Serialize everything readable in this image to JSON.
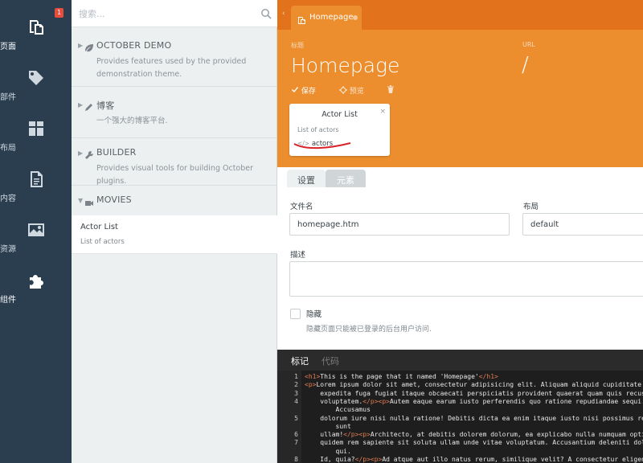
{
  "nav": {
    "badge": "1",
    "items": [
      {
        "label": "页面",
        "icon": "pages-icon"
      },
      {
        "label": "部件",
        "icon": "partials-icon"
      },
      {
        "label": "布局",
        "icon": "layouts-icon"
      },
      {
        "label": "内容",
        "icon": "content-icon"
      },
      {
        "label": "资源",
        "icon": "assets-icon"
      },
      {
        "label": "组件",
        "icon": "components-icon"
      }
    ]
  },
  "sidebar": {
    "search_placeholder": "搜索...",
    "groups": [
      {
        "title": "OCTOBER DEMO",
        "desc": "Provides features used by the provided demonstration theme."
      },
      {
        "title": "博客",
        "desc": "一个强大的博客平台."
      },
      {
        "title": "BUILDER",
        "desc": "Provides visual tools for building October plugins."
      },
      {
        "title": "MOVIES",
        "desc": ""
      }
    ],
    "component": {
      "title": "Actor List",
      "desc": "List of actors"
    }
  },
  "main": {
    "tab_label": "Homepage",
    "title_label": "标题",
    "title_value": "Homepage",
    "url_label": "URL",
    "url_value": "/",
    "toolbar": {
      "save": "保存",
      "preview": "预览"
    },
    "component_card": {
      "title": "Actor List",
      "close": "×",
      "desc": "List of actors",
      "code_icon": "</>",
      "alias": "actors"
    },
    "form_tabs": {
      "settings": "设置",
      "elements": "元素"
    },
    "file_name_label": "文件名",
    "file_name_value": "homepage.htm",
    "layout_label": "布局",
    "layout_value": "default",
    "description_label": "描述",
    "description_value": "",
    "hidden_label": "隐藏",
    "hidden_help": "隐藏页面只能被已登录的后台用户访问.",
    "code_tabs": {
      "markup": "标记",
      "code": "代码"
    },
    "code_lines": [
      {
        "n": "1",
        "text": "<h1>This is the page that it named 'Homepage'</h1>"
      },
      {
        "n": "2",
        "text": "<p>Lorem ipsum dolor sit amet, consectetur adipisicing elit. Aliquam aliquid cupiditate"
      },
      {
        "n": "3",
        "text": "    expedita fuga fugiat itaque obcaecati perspiciatis provident quaerat quam quis recusa"
      },
      {
        "n": "4",
        "text": "    voluptatem.</p><p>Autem eaque earum iusto perferendis quo ratione repudiandae sequi."
      },
      {
        "n": "",
        "text": "        Accusamus"
      },
      {
        "n": "5",
        "text": "    dolorum iure nisi nulla ratione! Debitis dicta ea enim itaque iusto nisi possimus re"
      },
      {
        "n": "",
        "text": "        sunt"
      },
      {
        "n": "6",
        "text": "    ullam!</p><p>Architecto, at debitis dolorem dolorum, ea explicabo nulla numquam opti"
      },
      {
        "n": "7",
        "text": "    quidem rem sapiente sit soluta ullam unde vitae voluptatum. Accusantium deleniti dol"
      },
      {
        "n": "",
        "text": "        qui."
      },
      {
        "n": "8",
        "text": "    Id, quia?</p><p>Ad atque aut illo natus rerum, similique velit? A consectetur eligen"
      }
    ]
  }
}
